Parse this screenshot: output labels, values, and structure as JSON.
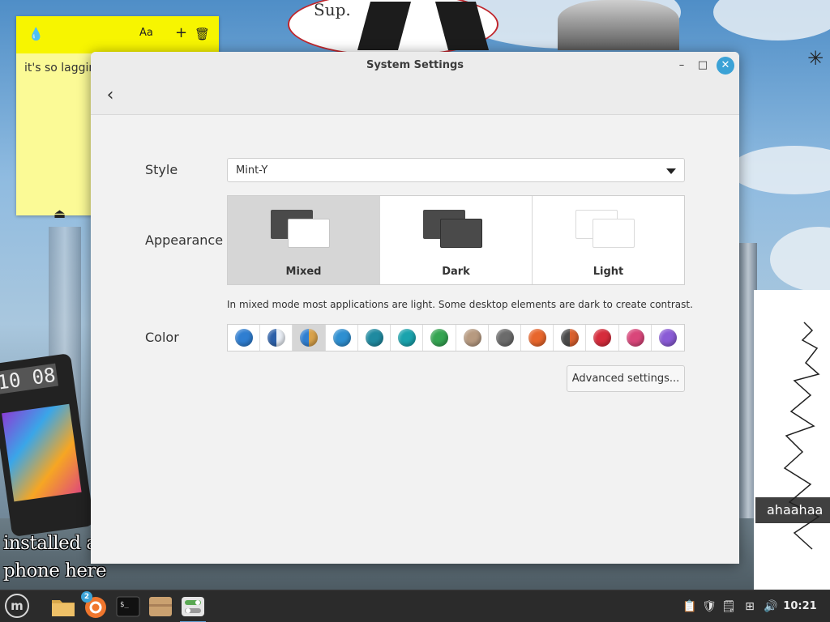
{
  "window": {
    "title": "System Settings",
    "back_label": "‹",
    "minimize_label": "–",
    "maximize_label": "□",
    "close_label": "✕"
  },
  "style": {
    "label": "Style",
    "selected": "Mint-Y"
  },
  "appearance": {
    "label": "Appearance",
    "options": [
      {
        "label": "Mixed",
        "selected": true
      },
      {
        "label": "Dark",
        "selected": false
      },
      {
        "label": "Light",
        "selected": false
      }
    ],
    "hint": "In mixed mode most applications are light. Some desktop elements are dark to create contrast."
  },
  "color": {
    "label": "Color",
    "swatches": [
      "#2f7ed1",
      "#2b5fa8",
      "#d9a24a",
      "#2e8fd1",
      "#1f8aa0",
      "#1aa3ad",
      "#35a552",
      "#b79a80",
      "#6b6b6b",
      "#e8662c",
      "#d9602e",
      "#d62c3c",
      "#d9467a",
      "#8a5bd6"
    ],
    "selected_index": 2
  },
  "advanced_button": "Advanced settings...",
  "sticky_note": {
    "text": "it's so lagging",
    "icons": [
      "drop-icon",
      "font-icon",
      "plus-icon",
      "trash-icon"
    ]
  },
  "desktop": {
    "sticker_text": "Sup.",
    "phone_clock": "10 08",
    "phone_caption_line1": "installed a gi",
    "phone_caption_line2": "phone here",
    "sketch_caption": "ahaahaa"
  },
  "taskbar": {
    "notification_count": "2",
    "clock": "10:21"
  }
}
